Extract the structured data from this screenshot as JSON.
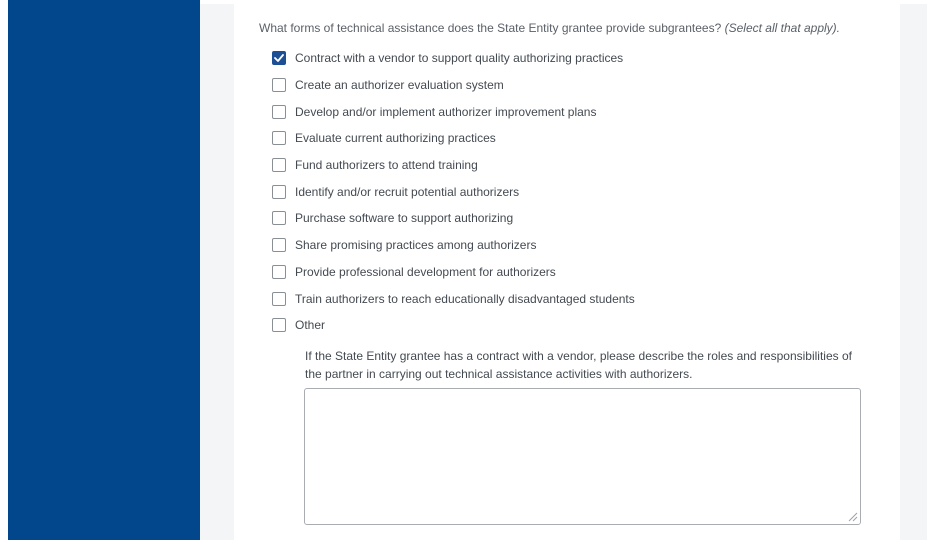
{
  "question": {
    "text": "What forms of technical assistance does the State Entity grantee provide subgrantees?",
    "hint": "(Select all that apply)."
  },
  "options": [
    {
      "label": "Contract with a vendor to support quality authorizing practices",
      "checked": true
    },
    {
      "label": "Create an authorizer evaluation system",
      "checked": false
    },
    {
      "label": "Develop and/or implement authorizer improvement plans",
      "checked": false
    },
    {
      "label": "Evaluate current authorizing practices",
      "checked": false
    },
    {
      "label": "Fund authorizers to attend training",
      "checked": false
    },
    {
      "label": "Identify and/or recruit potential authorizers",
      "checked": false
    },
    {
      "label": "Purchase software to support authorizing",
      "checked": false
    },
    {
      "label": "Share promising practices among authorizers",
      "checked": false
    },
    {
      "label": "Provide professional development for authorizers",
      "checked": false
    },
    {
      "label": "Train authorizers to reach educationally disadvantaged students",
      "checked": false
    },
    {
      "label": "Other",
      "checked": false
    }
  ],
  "followup": {
    "prompt": "If the State Entity grantee has a contract with a vendor, please describe the roles and responsibilities of the partner in carrying out technical assistance activities with authorizers.",
    "value": ""
  },
  "colors": {
    "sidebar": "#02478b",
    "checkbox_checked": "#1d4f95",
    "gutter": "#f4f5f6"
  },
  "icons": {
    "checked": "checkmark-icon",
    "resize": "resize-grip-icon"
  }
}
